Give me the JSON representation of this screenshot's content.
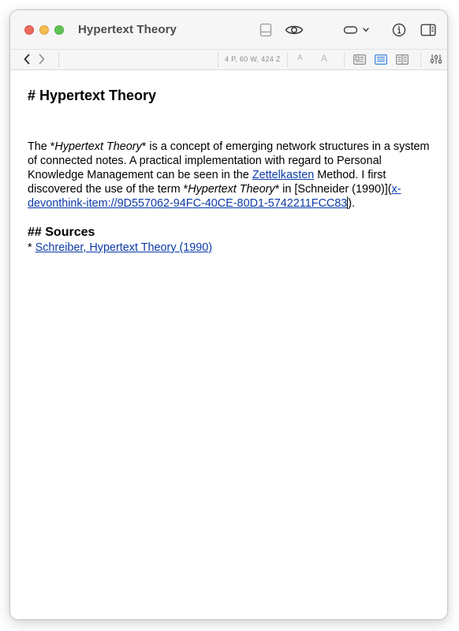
{
  "window": {
    "title": "Hypertext Theory"
  },
  "toolbar": {
    "stats": "4 P, 60 W, 424 Z",
    "font_smaller": "A",
    "font_larger": "A"
  },
  "document": {
    "heading": "# Hypertext Theory",
    "paragraph": {
      "p1": "The *",
      "em1": "Hypertext Theory",
      "p2": "* is a concept of emerging network structures in a system of connected notes. A practical implementation with regard to Personal Knowledge Management can be seen in the ",
      "link_zettelkasten": "Zettelkasten",
      "p3": " Method. I first discovered the use of the term *",
      "em2": "Hypertext Theory",
      "p4": "* in [Schneider (1990)](",
      "link_item": "x-devonthink-item://9D557062-94FC-40CE-80D1-5742211FCC83",
      "p5": ")."
    },
    "sources_heading": "## Sources",
    "list_bullet": "* ",
    "source_link": "Schreiber, Hypertext Theory (1990)"
  },
  "colors": {
    "link": "#0b3aa6",
    "close": "#ed6a5e",
    "minimize": "#f5bf4f",
    "maximize": "#61c454",
    "accent": "#2a7ad9"
  },
  "icons": {
    "nav_back": "chevron-left-icon",
    "nav_forward": "chevron-right-icon",
    "panel": "bottom-panel-icon",
    "preview": "eye-icon",
    "tag": "capsule-icon",
    "info": "info-icon",
    "sidebar": "sidebar-icon",
    "settings": "sliders-icon"
  }
}
